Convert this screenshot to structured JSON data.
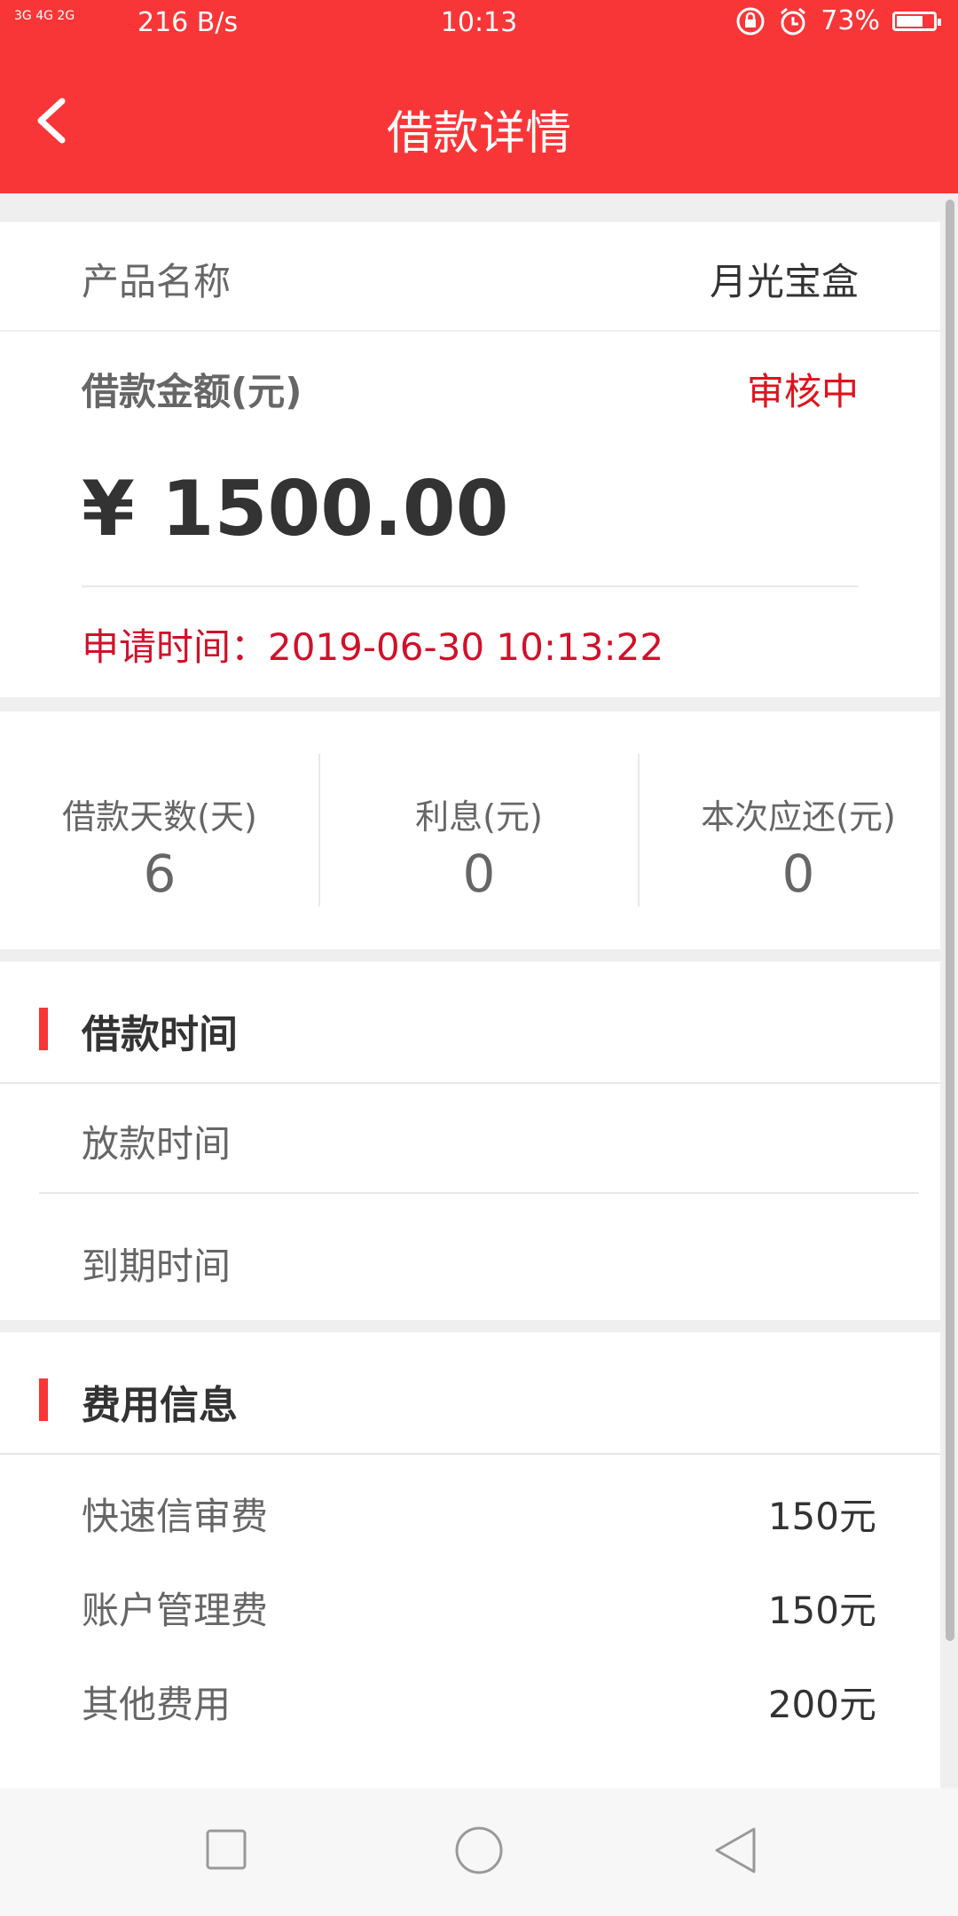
{
  "status_bar": {
    "network": "3G 4G 2G",
    "speed": "216 B/s",
    "time": "10:13",
    "battery": "73%",
    "battery_level": 0.73
  },
  "nav": {
    "title": "借款详情"
  },
  "product": {
    "label": "产品名称",
    "value": "月光宝盒"
  },
  "loan": {
    "amount_label": "借款金额(元)",
    "status": "审核中",
    "amount": "¥ 1500.00",
    "apply_time": "申请时间：2019-06-30 10:13:22"
  },
  "stats": [
    {
      "label": "借款天数(天)",
      "value": "6"
    },
    {
      "label": "利息(元)",
      "value": "0"
    },
    {
      "label": "本次应还(元)",
      "value": "0"
    }
  ],
  "loan_time": {
    "title": "借款时间",
    "rows": [
      {
        "label": "放款时间",
        "value": ""
      },
      {
        "label": "到期时间",
        "value": ""
      }
    ]
  },
  "fees": {
    "title": "费用信息",
    "rows": [
      {
        "label": "快速信审费",
        "value": "150元"
      },
      {
        "label": "账户管理费",
        "value": "150元"
      },
      {
        "label": "其他费用",
        "value": "200元"
      }
    ]
  },
  "colors": {
    "brand": "#f83638",
    "status": "#e0121c",
    "apply_time": "#d0112b"
  }
}
